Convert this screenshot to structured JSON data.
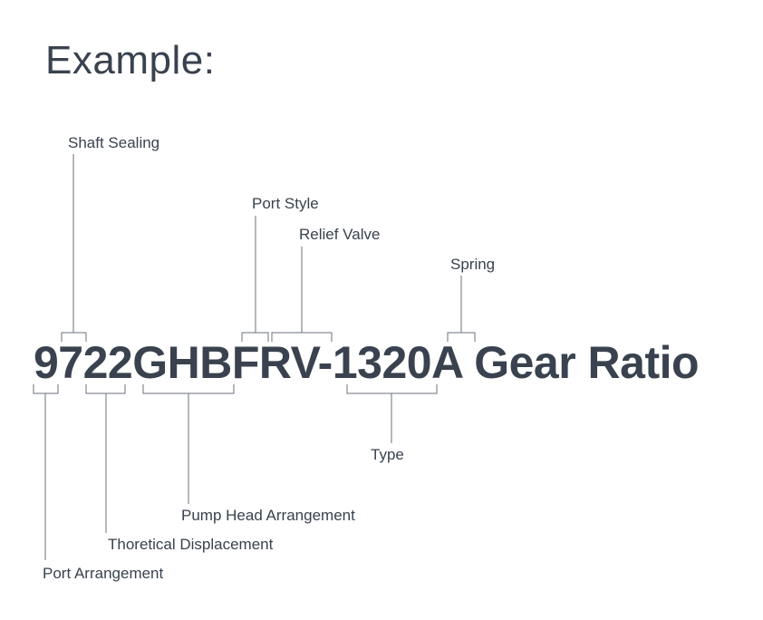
{
  "heading": "Example:",
  "code": "9722GHBFRV-1320A Gear Ratio",
  "labels": {
    "shaft_sealing": "Shaft Sealing",
    "port_style": "Port Style",
    "relief_valve": "Relief Valve",
    "spring": "Spring",
    "port_arrangement": "Port Arrangement",
    "theoretical_displacement": "Thoretical Displacement",
    "pump_head_arrangement": "Pump Head Arrangement",
    "type": "Type"
  }
}
